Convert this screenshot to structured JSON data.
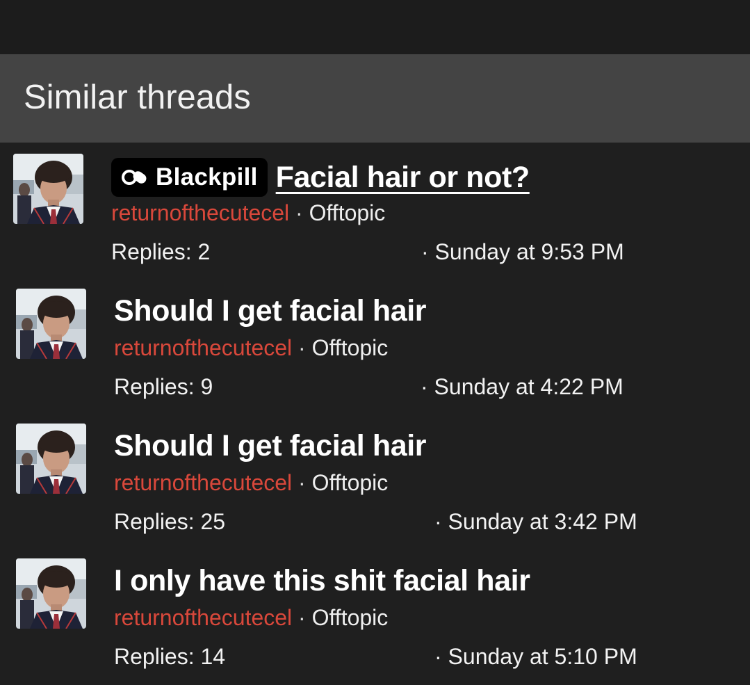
{
  "section": {
    "title": "Similar threads"
  },
  "threads": [
    {
      "prefix": {
        "label": "Blackpill",
        "icon": "pills-icon"
      },
      "title": "Facial hair or not?",
      "author": "returnofthecutecel",
      "separator": "·",
      "forum": "Offtopic",
      "replies": "Replies: 2",
      "date": "· Sunday at 9:53 PM"
    },
    {
      "title": "Should I get facial hair",
      "author": "returnofthecutecel",
      "separator": "·",
      "forum": "Offtopic",
      "replies": "Replies: 9",
      "date": "· Sunday at 4:22 PM"
    },
    {
      "title": "Should I get facial hair",
      "author": "returnofthecutecel",
      "separator": "·",
      "forum": "Offtopic",
      "replies": "Replies: 25",
      "date": "· Sunday at 3:42 PM"
    },
    {
      "title": "I only have this shit facial hair",
      "author": "returnofthecutecel",
      "separator": "·",
      "forum": "Offtopic",
      "replies": "Replies: 14",
      "date": "· Sunday at 5:10 PM"
    }
  ],
  "colors": {
    "background": "#1f1f1f",
    "header_background": "#444444",
    "author": "#d9483b",
    "text": "#ffffff"
  }
}
